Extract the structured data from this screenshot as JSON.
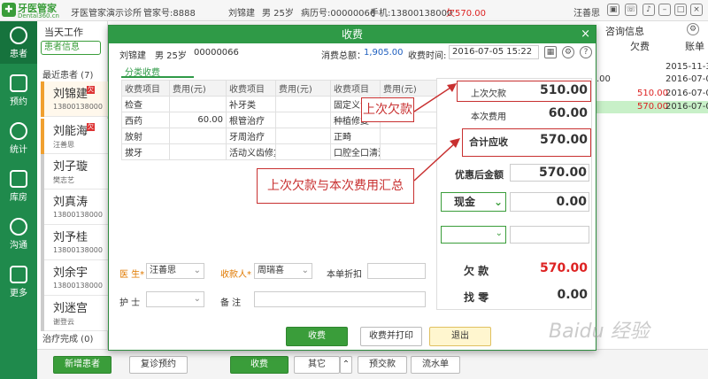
{
  "topbar": {
    "logo_main": "牙医管家",
    "logo_sub": "Dental360.cn",
    "clinic": "牙医管家演示诊所",
    "account": "管家号:8888",
    "patient_name": "刘锦建",
    "patient_sex_age": "男 25岁",
    "record_no": "病历号:00000066",
    "phone": "手机:13800138000",
    "debt": "欠570.00",
    "user": "汪善思"
  },
  "nav": [
    {
      "label": "患者",
      "icon": "patient-icon"
    },
    {
      "label": "预约",
      "icon": "calendar-icon"
    },
    {
      "label": "统计",
      "icon": "chart-icon"
    },
    {
      "label": "库房",
      "icon": "warehouse-icon"
    },
    {
      "label": "沟通",
      "icon": "play-icon"
    },
    {
      "label": "更多",
      "icon": "grid-icon"
    }
  ],
  "panel": {
    "tab": "当天工作",
    "select": "患者信息",
    "group_recent": "最近患者 (7)",
    "group_done": "治疗完成 (0)",
    "patients": [
      {
        "name": "刘锦建",
        "sub": "13800138000"
      },
      {
        "name": "刘能海",
        "sub": "汪善思"
      },
      {
        "name": "刘子璇",
        "sub": "樊志艺"
      },
      {
        "name": "刘真涛",
        "sub": "13800138000"
      },
      {
        "name": "刘予桂",
        "sub": "13800138000"
      },
      {
        "name": "刘余宇",
        "sub": "13800138000"
      },
      {
        "name": "刘迷宫",
        "sub": "谢登云"
      }
    ]
  },
  "bgtable": {
    "tab": "咨询信息",
    "col_debt": "欠费",
    "col_date": "账单",
    "rows": [
      {
        "debt": "",
        "date": "2015-11-3"
      },
      {
        "debt": "",
        "date": "2016-07-0"
      },
      {
        "debt": "510.00",
        "date": "2016-07-0"
      },
      {
        "debt": "570.00",
        "date": "2016-07-0"
      }
    ],
    "partial_value": ".00"
  },
  "bottombar": {
    "new_patient": "新增患者",
    "revisit": "复诊预约",
    "charge": "收费",
    "other": "其它",
    "prepay": "预交款",
    "bill": "流水单"
  },
  "modal": {
    "title": "收费",
    "close": "×",
    "patient": "刘锦建",
    "sex_age": "男  25岁",
    "record": "00000066",
    "total_label": "消费总额：",
    "total_value": "1,905.00",
    "time_label": "收费时间:",
    "time_value": "2016-07-05  15:22",
    "category_tab": "分类收费",
    "table_head": [
      "收费项目",
      "费用(元)",
      "收费项目",
      "费用(元)",
      "收费项目",
      "费用(元)"
    ],
    "table_rows": [
      [
        "检查",
        "",
        "补牙类",
        "",
        "固定义齿修复",
        ""
      ],
      [
        "西药",
        "60.00",
        "根管治疗",
        "",
        "种植修复",
        ""
      ],
      [
        "放射",
        "",
        "牙周治疗",
        "",
        "正畸",
        ""
      ],
      [
        "拔牙",
        "",
        "活动义齿修复",
        "",
        "口腔全口清洁",
        ""
      ]
    ],
    "doctor_label": "医 生*",
    "doctor_value": "汪善思",
    "cashier_label": "收款人*",
    "cashier_value": "周瑞喜",
    "discount_label": "本单折扣",
    "nurse_label": "护 士",
    "note_label": "备 注",
    "pay": {
      "last_debt_label": "上次欠款",
      "last_debt_value": "510.00",
      "this_fee_label": "本次费用",
      "this_fee_value": "60.00",
      "total_due_label": "合计应收",
      "total_due_value": "570.00",
      "after_discount_label": "优惠后金额",
      "after_discount_value": "570.00",
      "method": "现金",
      "method_value": "0.00",
      "arrears_label": "欠    款",
      "arrears_value": "570.00",
      "change_label": "找    零",
      "change_value": "0.00"
    },
    "buttons": {
      "charge": "收费",
      "charge_print": "收费并打印",
      "exit": "退出"
    }
  },
  "annotations": {
    "label1": "上次欠款",
    "label2": "上次欠款与本次费用汇总"
  },
  "watermark": "Baidu 经验"
}
